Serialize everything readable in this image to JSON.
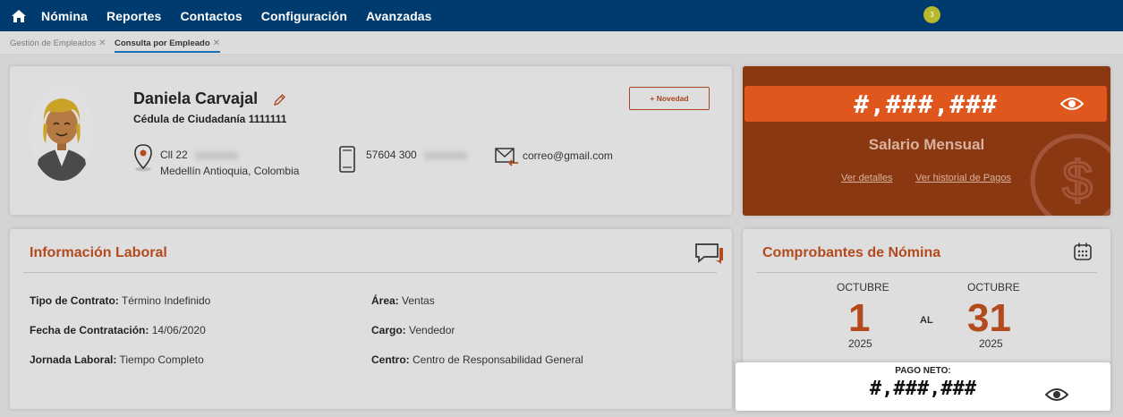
{
  "nav": {
    "items": [
      "Nómina",
      "Reportes",
      "Contactos",
      "Configuración",
      "Avanzadas"
    ],
    "notification_count": "3"
  },
  "tabs": [
    {
      "label": "Gestión de Empleados",
      "active": false
    },
    {
      "label": "Consulta por Empleado",
      "active": true
    }
  ],
  "employee": {
    "name": "Daniela Carvajal",
    "id_label": "Cédula de Ciudadanía 1111111",
    "address_line1": "Cll 22",
    "address_line2": "Medellín Antioquia, Colombia",
    "phone": "57604 300",
    "email": "correo@gmail.com"
  },
  "actions": {
    "novedad": "+ Novedad"
  },
  "salary": {
    "masked_value": "#,###,###",
    "label": "Salario Mensual",
    "link_details": "Ver detalles",
    "link_history": "Ver historial de Pagos"
  },
  "labor": {
    "title": "Información Laboral",
    "contract_label": "Tipo de Contrato:",
    "contract_value": "Término Indefinido",
    "hire_label": "Fecha de Contratación:",
    "hire_value": "14/06/2020",
    "schedule_label": "Jornada Laboral:",
    "schedule_value": "Tiempo Completo",
    "area_label": "Área:",
    "area_value": "Ventas",
    "role_label": "Cargo:",
    "role_value": "Vendedor",
    "center_label": "Centro:",
    "center_value": "Centro de Responsabilidad General"
  },
  "payroll": {
    "title": "Comprobantes de Nómina",
    "from_month": "OCTUBRE",
    "from_day": "1",
    "from_year": "2025",
    "separator": "AL",
    "to_month": "OCTUBRE",
    "to_day": "31",
    "to_year": "2025",
    "net_label": "PAGO NETO:",
    "net_masked": "#,###,###"
  },
  "colors": {
    "nav_bg": "#003b70",
    "accent": "#b34a1e",
    "salary_card": "#8a3812",
    "salary_bar": "#e0571e"
  }
}
